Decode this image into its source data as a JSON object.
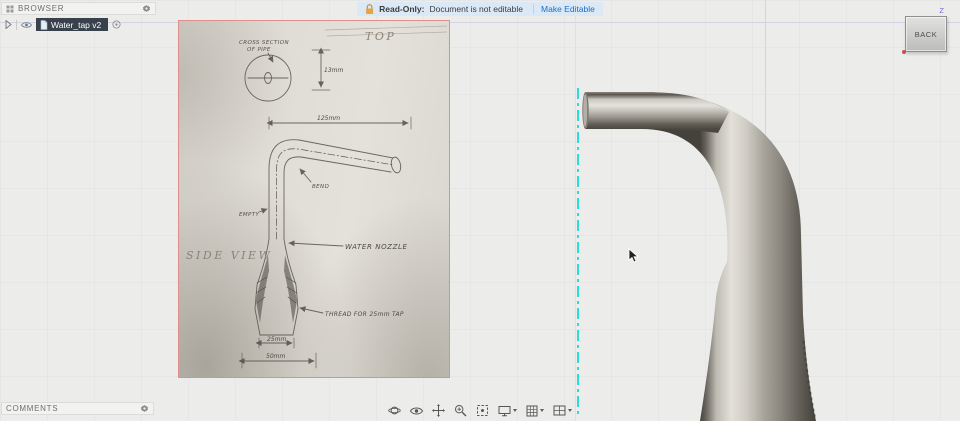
{
  "browser_panel": {
    "title": "BROWSER",
    "document_label": "Water_tap v2"
  },
  "comments_panel": {
    "title": "COMMENTS"
  },
  "readonly_banner": {
    "label": "Read-Only:",
    "message": "Document is not editable",
    "action": "Make Editable"
  },
  "viewcube": {
    "face": "BACK",
    "axis_z": "Z"
  },
  "sketch": {
    "top_view_label": "TOP",
    "side_view_label": "SIDE VIEW",
    "cross_section_line1": "CROSS SECTION",
    "cross_section_line2": "OF PIPE",
    "dim_pipe": "13mm",
    "dim_length": "125mm",
    "bend_label": "BEND",
    "empty_label": "EMPTY",
    "water_nozzle_label": "WATER NOZZLE",
    "thread_note": "THREAD FOR 25mm TAP",
    "dim_base_top": "25mm",
    "dim_base_bottom": "50mm"
  },
  "nav_toolbar": {
    "icons": [
      "orbit-icon",
      "look-at-icon",
      "pan-icon",
      "zoom-icon",
      "fit-icon",
      "display-settings-icon",
      "grid-snaps-icon",
      "viewports-icon"
    ]
  },
  "colors": {
    "canvas_border": "#dd908b",
    "centerline_cyan": "#2bdcdc",
    "grid_major": "#d7d1e6",
    "selection_bg": "#39414d",
    "banner_bg": "#dbe9f7",
    "link_blue": "#1a6fc4",
    "lock_orange": "#e8a33d"
  }
}
